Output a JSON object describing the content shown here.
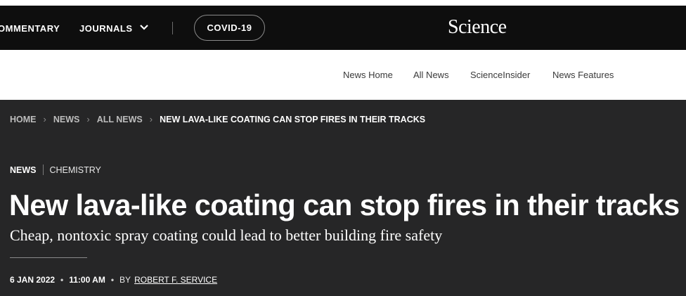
{
  "topbar": {
    "commentary_label": "OMMENTARY",
    "journals_label": "JOURNALS",
    "covid_label": "COVID-19",
    "logo_text": "Science"
  },
  "subnav": {
    "items": [
      {
        "label": "News Home"
      },
      {
        "label": "All News"
      },
      {
        "label": "ScienceInsider"
      },
      {
        "label": "News Features"
      }
    ]
  },
  "breadcrumb": {
    "home": "HOME",
    "news": "NEWS",
    "all_news": "ALL NEWS",
    "current": "NEW LAVA-LIKE COATING CAN STOP FIRES IN THEIR TRACKS"
  },
  "article": {
    "section": "NEWS",
    "topic": "CHEMISTRY",
    "title": "New lava-like coating can stop fires in their tracks",
    "deck": "Cheap, nontoxic spray coating could lead to better building fire safety",
    "date": "6 JAN 2022",
    "time": "11:00 AM",
    "by_label": "BY",
    "author": "ROBERT F. SERVICE"
  },
  "colors": {
    "topbar_bg": "#0e0e0e",
    "page_bg": "#262627",
    "subnav_bg": "#ffffff"
  },
  "icons": {
    "journals_dropdown": "chevron-down-icon",
    "breadcrumb_separator": "chevron-right-icon"
  }
}
